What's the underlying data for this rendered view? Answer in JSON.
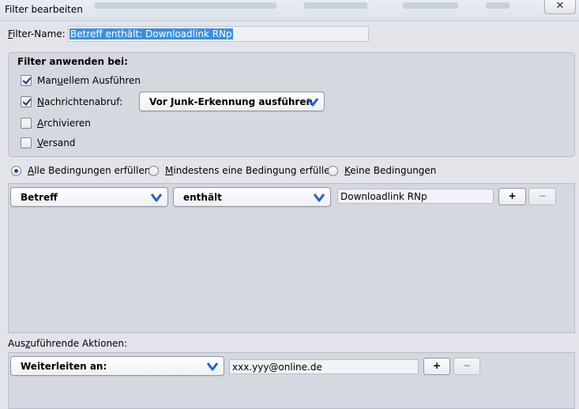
{
  "window": {
    "title": "Filter bearbeiten",
    "close_symbol": "✕"
  },
  "filter_name": {
    "label_accesskey": "F",
    "label_rest": "ilter-Name:",
    "value": "Betreff enthält: Downloadlink RNp"
  },
  "apply_group": {
    "legend": "Filter anwenden bei:",
    "manual": {
      "pre": "Man",
      "key": "u",
      "post": "ellem Ausführen",
      "checked": true
    },
    "fetch": {
      "pre": "",
      "key": "N",
      "post": "achrichtenabruf:",
      "checked": true
    },
    "fetch_option": "Vor Junk-Erkennung ausführen",
    "archive": {
      "pre": "",
      "key": "A",
      "post": "rchivieren",
      "checked": false
    },
    "send": {
      "pre": "",
      "key": "V",
      "post": "ersand",
      "checked": false
    }
  },
  "match_mode": {
    "all": {
      "key": "A",
      "post": "lle Bedingungen erfüllen",
      "selected": true
    },
    "any": {
      "key": "M",
      "post": "indestens eine Bedingung erfüllen",
      "selected": false
    },
    "none": {
      "key": "K",
      "post": "eine Bedingungen",
      "selected": false
    }
  },
  "condition": {
    "field": "Betreff",
    "operator": "enthält",
    "value": "Downloadlink RNp",
    "add": "+",
    "remove": "−"
  },
  "actions": {
    "label_pre": "Aus",
    "label_key": "z",
    "label_post": "uführende Aktionen:",
    "action": "Weiterleiten an:",
    "target": "xxx.yyy@online.de",
    "add": "+",
    "remove": "−"
  },
  "colors": {
    "selection": "#3a8ee6",
    "chevron": "#1e64c8"
  }
}
